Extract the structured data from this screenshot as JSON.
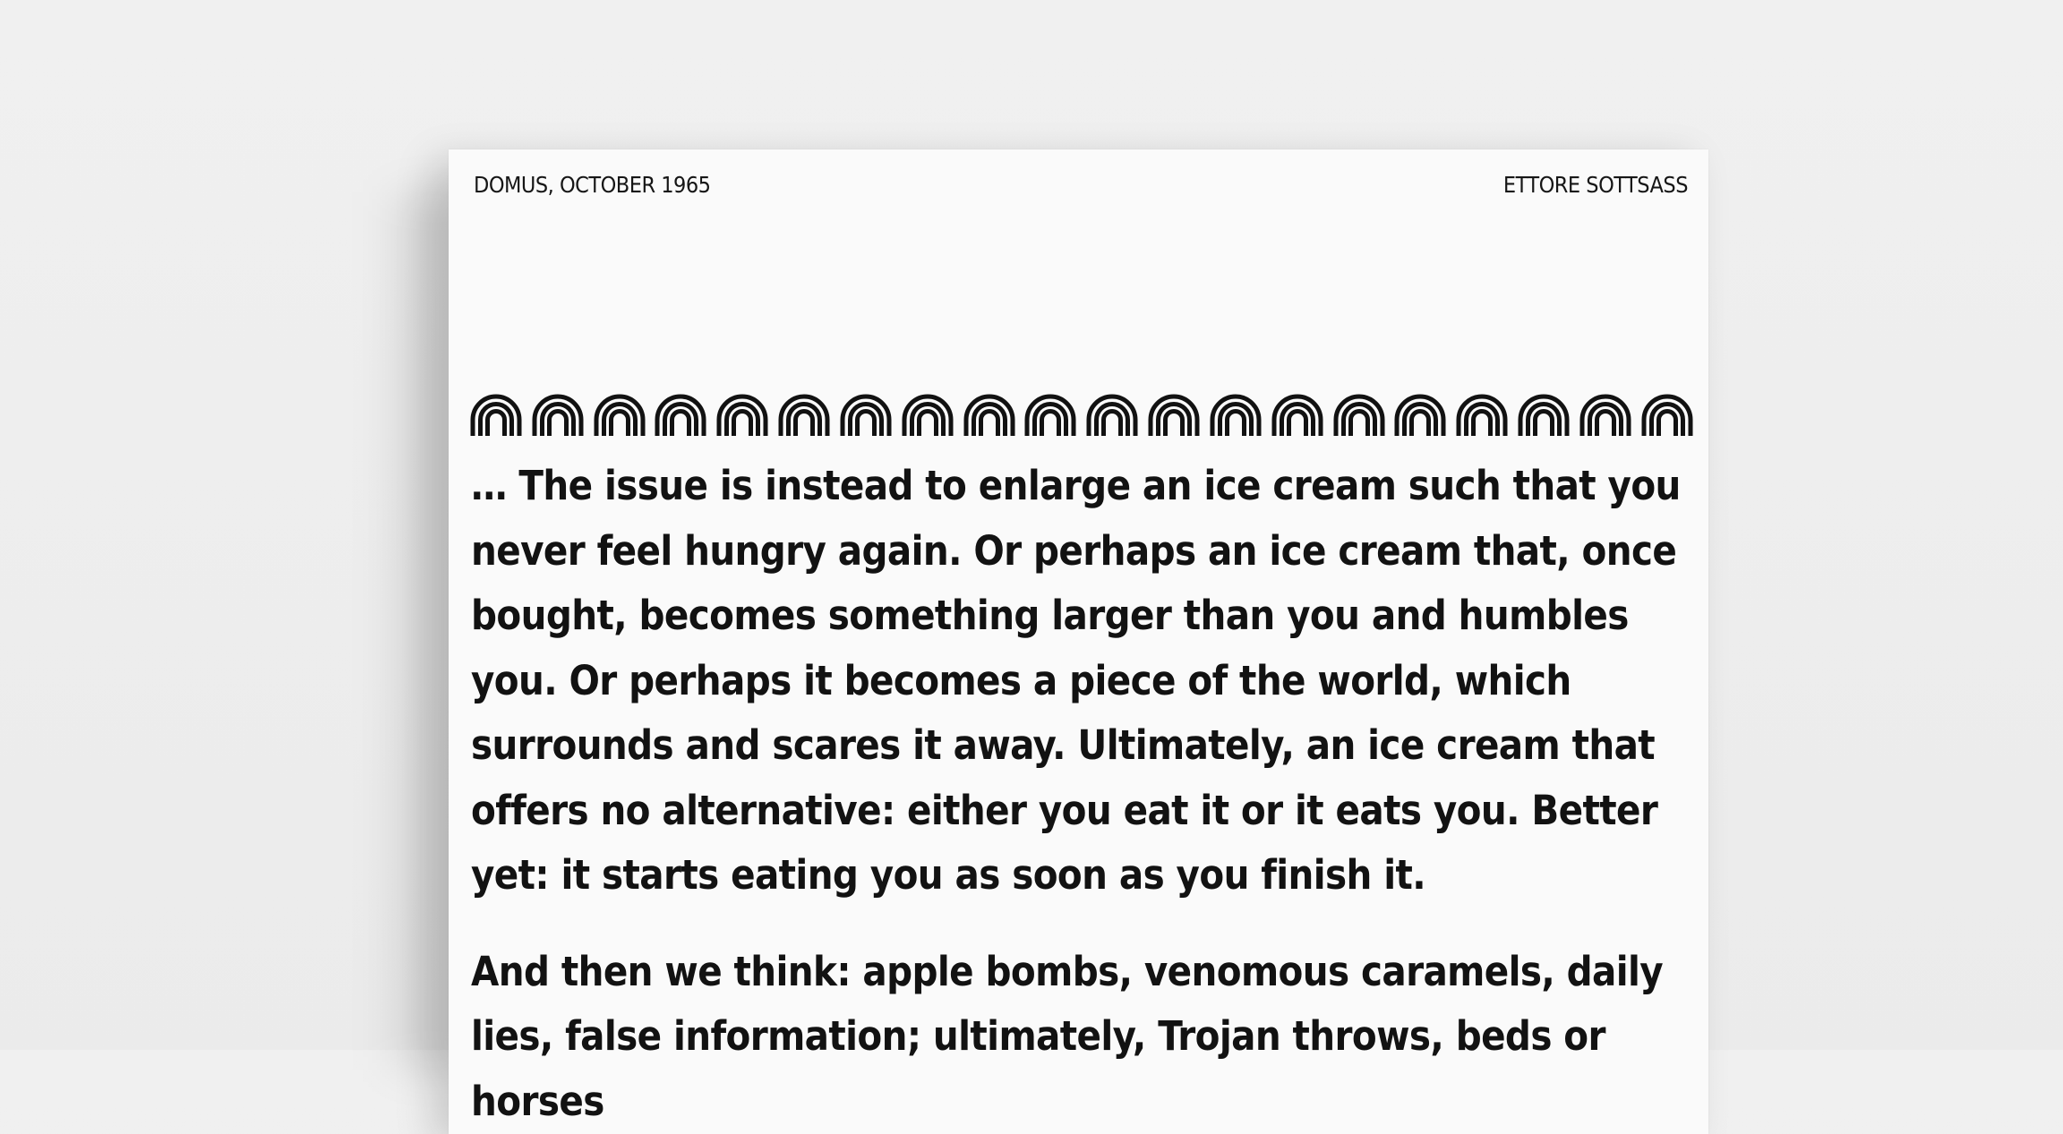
{
  "poster": {
    "header_left": "DOMUS, OCTOBER 1965",
    "header_right": "ETTORE SOTTSASS",
    "ornament": {
      "icon": "rainbow-arch-icon",
      "count": 20
    },
    "paragraph_1": "… The issue is instead to enlarge an ice cream such that you never feel hungry again. Or perhaps an ice cream that, once bought, becomes something larger than you and humbles you. Or perhaps it becomes a piece of the world, which surrounds and scares it away. Ultimately, an ice cream that offers no alternative: either you eat it or it eats you. Better yet: it starts eating you as soon as you finish it.",
    "paragraph_2": "And then we think: apple bombs, venomous caramels, daily lies, false information; ultimately, Trojan throws, beds or horses"
  },
  "colors": {
    "background": "#eeeeee",
    "paper": "#fafafa",
    "ink": "#121212"
  }
}
